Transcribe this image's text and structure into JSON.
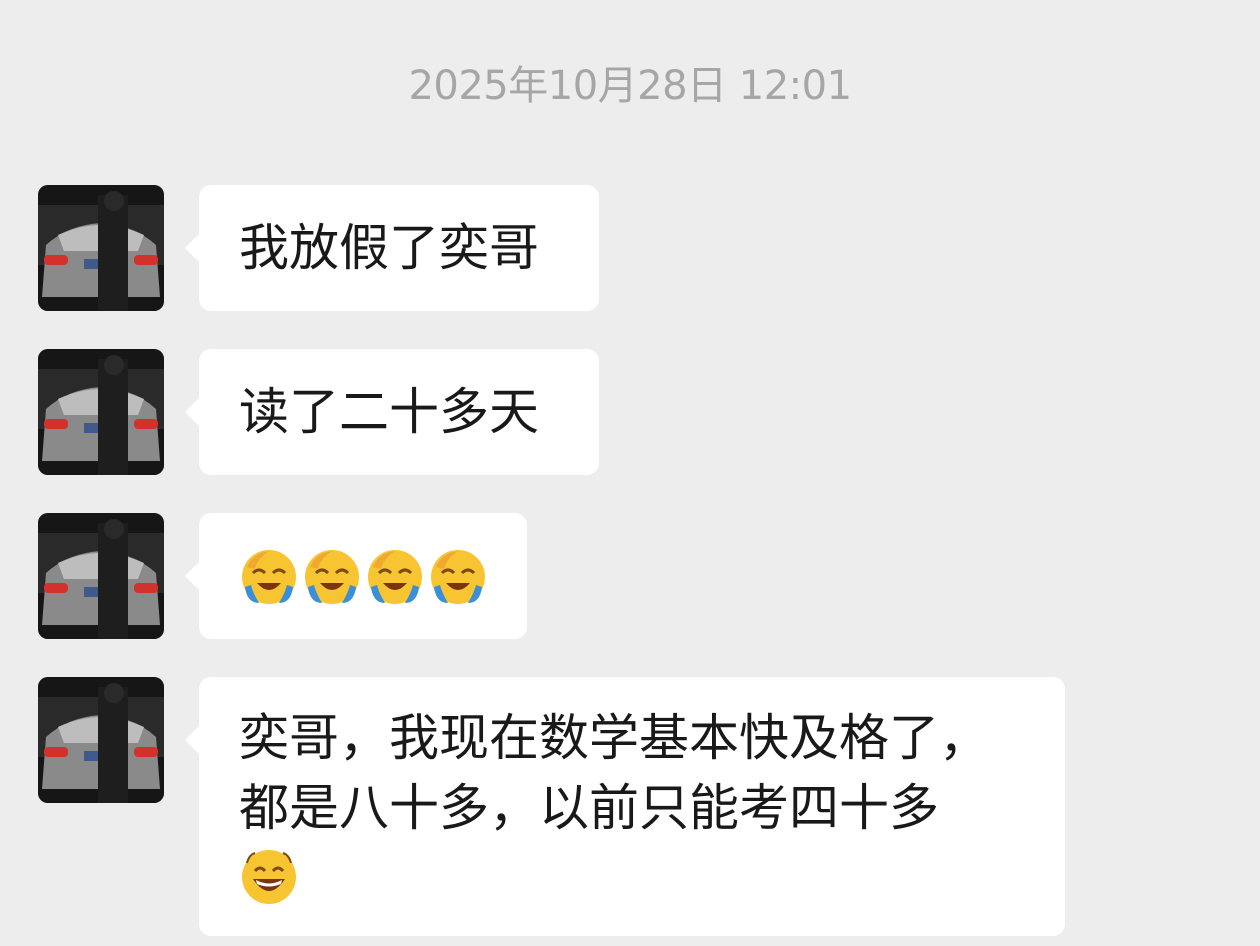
{
  "timestamp": "2025年10月28日 12:01",
  "messages": [
    {
      "sender": "other",
      "text": "我放假了奕哥"
    },
    {
      "sender": "other",
      "text": "读了二十多天"
    },
    {
      "sender": "other",
      "emojis": [
        "face-holding-back-tears-laughing-emoji",
        "face-holding-back-tears-laughing-emoji",
        "face-holding-back-tears-laughing-emoji",
        "face-holding-back-tears-laughing-emoji"
      ]
    },
    {
      "sender": "other",
      "text": "奕哥，我现在数学基本快及格了，都是八十多，以前只能考四十多",
      "trailing_emoji": "grinning-face-emoji"
    }
  ],
  "colors": {
    "background": "#ededed",
    "bubble": "#ffffff",
    "text": "#191919",
    "timestamp": "#a6a6a6"
  }
}
